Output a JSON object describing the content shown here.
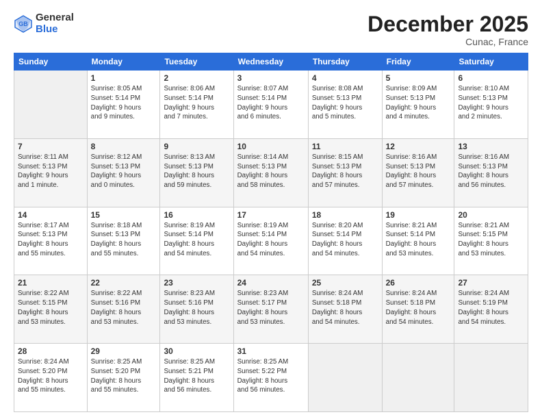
{
  "logo": {
    "general": "General",
    "blue": "Blue"
  },
  "title": "December 2025",
  "location": "Cunac, France",
  "days_of_week": [
    "Sunday",
    "Monday",
    "Tuesday",
    "Wednesday",
    "Thursday",
    "Friday",
    "Saturday"
  ],
  "weeks": [
    [
      {
        "day": "",
        "info": ""
      },
      {
        "day": "1",
        "info": "Sunrise: 8:05 AM\nSunset: 5:14 PM\nDaylight: 9 hours\nand 9 minutes."
      },
      {
        "day": "2",
        "info": "Sunrise: 8:06 AM\nSunset: 5:14 PM\nDaylight: 9 hours\nand 7 minutes."
      },
      {
        "day": "3",
        "info": "Sunrise: 8:07 AM\nSunset: 5:14 PM\nDaylight: 9 hours\nand 6 minutes."
      },
      {
        "day": "4",
        "info": "Sunrise: 8:08 AM\nSunset: 5:13 PM\nDaylight: 9 hours\nand 5 minutes."
      },
      {
        "day": "5",
        "info": "Sunrise: 8:09 AM\nSunset: 5:13 PM\nDaylight: 9 hours\nand 4 minutes."
      },
      {
        "day": "6",
        "info": "Sunrise: 8:10 AM\nSunset: 5:13 PM\nDaylight: 9 hours\nand 2 minutes."
      }
    ],
    [
      {
        "day": "7",
        "info": "Sunrise: 8:11 AM\nSunset: 5:13 PM\nDaylight: 9 hours\nand 1 minute."
      },
      {
        "day": "8",
        "info": "Sunrise: 8:12 AM\nSunset: 5:13 PM\nDaylight: 9 hours\nand 0 minutes."
      },
      {
        "day": "9",
        "info": "Sunrise: 8:13 AM\nSunset: 5:13 PM\nDaylight: 8 hours\nand 59 minutes."
      },
      {
        "day": "10",
        "info": "Sunrise: 8:14 AM\nSunset: 5:13 PM\nDaylight: 8 hours\nand 58 minutes."
      },
      {
        "day": "11",
        "info": "Sunrise: 8:15 AM\nSunset: 5:13 PM\nDaylight: 8 hours\nand 57 minutes."
      },
      {
        "day": "12",
        "info": "Sunrise: 8:16 AM\nSunset: 5:13 PM\nDaylight: 8 hours\nand 57 minutes."
      },
      {
        "day": "13",
        "info": "Sunrise: 8:16 AM\nSunset: 5:13 PM\nDaylight: 8 hours\nand 56 minutes."
      }
    ],
    [
      {
        "day": "14",
        "info": "Sunrise: 8:17 AM\nSunset: 5:13 PM\nDaylight: 8 hours\nand 55 minutes."
      },
      {
        "day": "15",
        "info": "Sunrise: 8:18 AM\nSunset: 5:13 PM\nDaylight: 8 hours\nand 55 minutes."
      },
      {
        "day": "16",
        "info": "Sunrise: 8:19 AM\nSunset: 5:14 PM\nDaylight: 8 hours\nand 54 minutes."
      },
      {
        "day": "17",
        "info": "Sunrise: 8:19 AM\nSunset: 5:14 PM\nDaylight: 8 hours\nand 54 minutes."
      },
      {
        "day": "18",
        "info": "Sunrise: 8:20 AM\nSunset: 5:14 PM\nDaylight: 8 hours\nand 54 minutes."
      },
      {
        "day": "19",
        "info": "Sunrise: 8:21 AM\nSunset: 5:14 PM\nDaylight: 8 hours\nand 53 minutes."
      },
      {
        "day": "20",
        "info": "Sunrise: 8:21 AM\nSunset: 5:15 PM\nDaylight: 8 hours\nand 53 minutes."
      }
    ],
    [
      {
        "day": "21",
        "info": "Sunrise: 8:22 AM\nSunset: 5:15 PM\nDaylight: 8 hours\nand 53 minutes."
      },
      {
        "day": "22",
        "info": "Sunrise: 8:22 AM\nSunset: 5:16 PM\nDaylight: 8 hours\nand 53 minutes."
      },
      {
        "day": "23",
        "info": "Sunrise: 8:23 AM\nSunset: 5:16 PM\nDaylight: 8 hours\nand 53 minutes."
      },
      {
        "day": "24",
        "info": "Sunrise: 8:23 AM\nSunset: 5:17 PM\nDaylight: 8 hours\nand 53 minutes."
      },
      {
        "day": "25",
        "info": "Sunrise: 8:24 AM\nSunset: 5:18 PM\nDaylight: 8 hours\nand 54 minutes."
      },
      {
        "day": "26",
        "info": "Sunrise: 8:24 AM\nSunset: 5:18 PM\nDaylight: 8 hours\nand 54 minutes."
      },
      {
        "day": "27",
        "info": "Sunrise: 8:24 AM\nSunset: 5:19 PM\nDaylight: 8 hours\nand 54 minutes."
      }
    ],
    [
      {
        "day": "28",
        "info": "Sunrise: 8:24 AM\nSunset: 5:20 PM\nDaylight: 8 hours\nand 55 minutes."
      },
      {
        "day": "29",
        "info": "Sunrise: 8:25 AM\nSunset: 5:20 PM\nDaylight: 8 hours\nand 55 minutes."
      },
      {
        "day": "30",
        "info": "Sunrise: 8:25 AM\nSunset: 5:21 PM\nDaylight: 8 hours\nand 56 minutes."
      },
      {
        "day": "31",
        "info": "Sunrise: 8:25 AM\nSunset: 5:22 PM\nDaylight: 8 hours\nand 56 minutes."
      },
      {
        "day": "",
        "info": ""
      },
      {
        "day": "",
        "info": ""
      },
      {
        "day": "",
        "info": ""
      }
    ]
  ]
}
